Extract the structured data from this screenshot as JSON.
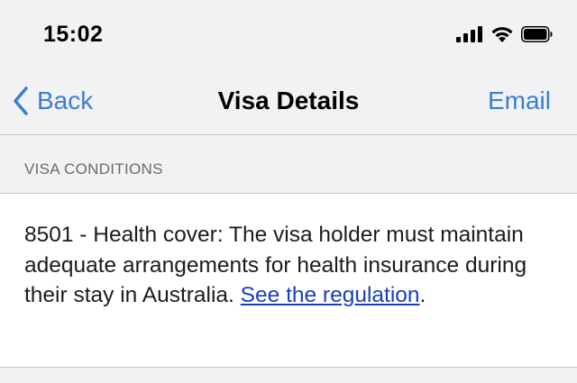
{
  "status_bar": {
    "time": "15:02",
    "icons": [
      "signal-icon",
      "wifi-icon",
      "battery-icon"
    ]
  },
  "nav": {
    "back_label": "Back",
    "title": "Visa Details",
    "action_label": "Email",
    "accent_color": "#3a7fd1"
  },
  "section": {
    "title": "VISA CONDITIONS"
  },
  "condition": {
    "text": "8501 - Health cover: The visa holder must maintain adequate arrangements for health insurance during their stay in Australia.",
    "link_label": "See the regulation",
    "link_suffix": ".",
    "link_color": "#1a3fb8"
  }
}
